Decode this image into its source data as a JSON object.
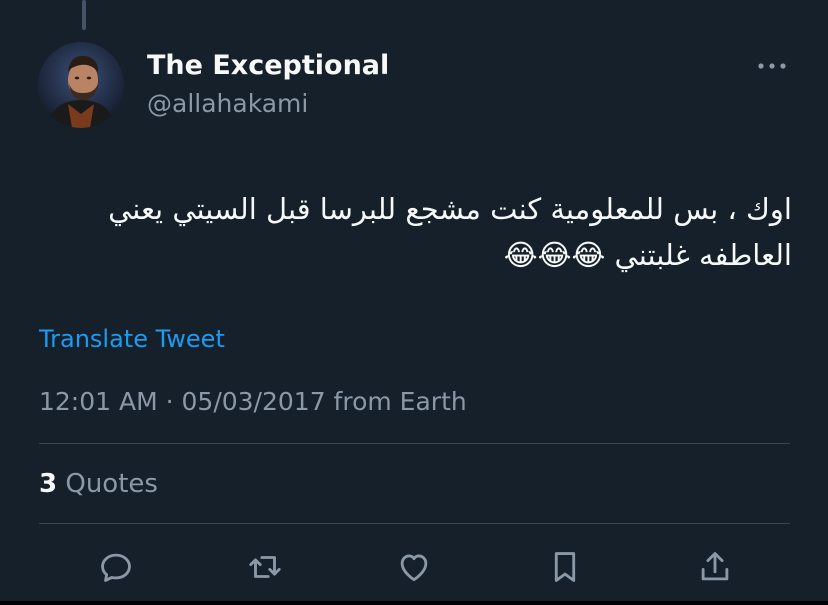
{
  "colors": {
    "background": "#15202b",
    "text_primary": "#f7f9f9",
    "text_secondary": "#8b98a5",
    "link": "#1d9bf0",
    "divider": "#38444d"
  },
  "author": {
    "name": "The Exceptional",
    "handle": "@allahakami",
    "avatar_icon": "profile-photo"
  },
  "tweet": {
    "text_line1": "اوك ، بس للمعلومية كنت مشجع للبرسا قبل السيتي يعني",
    "text_line2": "العاطفه غلبتني 😂😂😂",
    "translate_label": "Translate Tweet",
    "timestamp": "12:01 AM · 05/03/2017 from Earth"
  },
  "stats": {
    "quotes_count": "3",
    "quotes_label": "Quotes"
  },
  "actions": [
    {
      "icon": "reply-icon"
    },
    {
      "icon": "retweet-icon"
    },
    {
      "icon": "like-icon"
    },
    {
      "icon": "bookmark-icon"
    },
    {
      "icon": "share-icon"
    }
  ]
}
